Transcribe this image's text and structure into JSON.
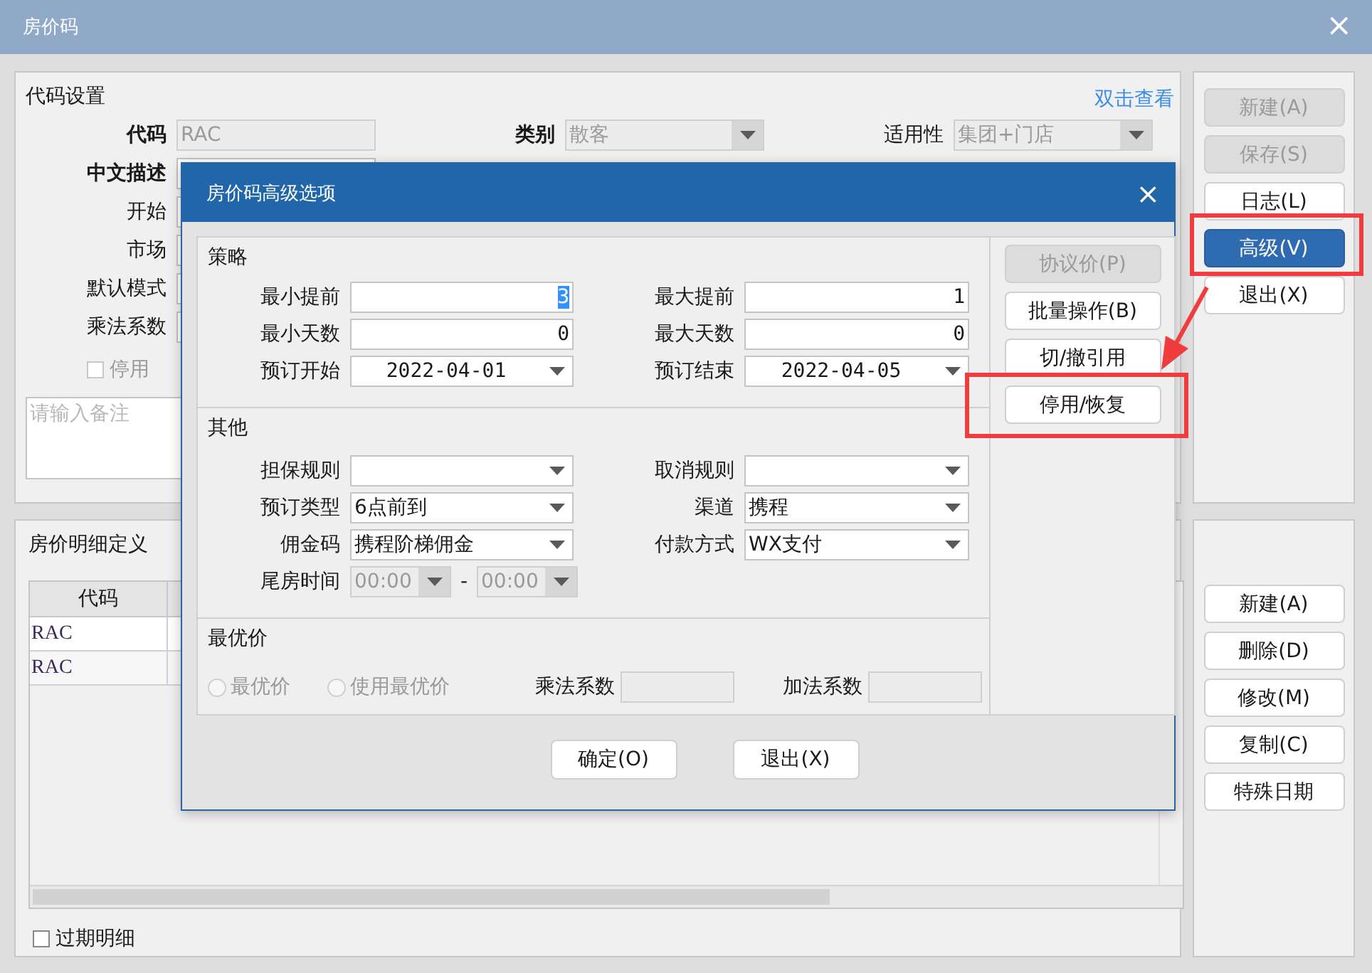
{
  "window": {
    "title": "房价码",
    "close": "×"
  },
  "code_settings": {
    "title": "代码设置",
    "link": "双击查看",
    "row1": [
      {
        "label": "代码",
        "bold": true,
        "field": {
          "kind": "text",
          "value": "RAC",
          "disabled": true
        }
      },
      {
        "label": "类别",
        "bold": true,
        "field": {
          "kind": "select",
          "value": "散客",
          "disabled": true
        }
      },
      {
        "label": "适用性",
        "bold": false,
        "field": {
          "kind": "select",
          "value": "集团+门店",
          "disabled": true
        }
      }
    ],
    "rows": [
      {
        "label": "中文描述",
        "bold": true
      },
      {
        "label": "开始",
        "bold": false
      },
      {
        "label": "市场",
        "bold": false
      },
      {
        "label": "默认模式",
        "bold": false
      },
      {
        "label": "乘法系数",
        "bold": false
      }
    ],
    "disable_check": {
      "label": "停用",
      "checked": false,
      "disabled": true
    },
    "remark": {
      "placeholder": "请输入备注"
    }
  },
  "main_buttons": [
    {
      "label": "新建(A)",
      "disabled": true,
      "selected": false
    },
    {
      "label": "保存(S)",
      "disabled": true,
      "selected": false
    },
    {
      "label": "日志(L)",
      "disabled": false,
      "selected": false
    },
    {
      "label": "高级(V)",
      "disabled": false,
      "selected": true
    },
    {
      "label": "退出(X)",
      "disabled": false,
      "selected": false
    }
  ],
  "detail": {
    "title": "房价明细定义",
    "columns": [
      "代码"
    ],
    "rows": [
      [
        "RAC"
      ],
      [
        "RAC"
      ]
    ],
    "expired_check": {
      "label": "过期明细",
      "checked": false
    }
  },
  "detail_buttons": [
    "新建(A)",
    "删除(D)",
    "修改(M)",
    "复制(C)",
    "特殊日期"
  ],
  "dialog": {
    "title": "房价码高级选项",
    "close": "×",
    "strategy": {
      "title": "策略",
      "rows": [
        [
          {
            "label": "最小提前",
            "field": {
              "kind": "number",
              "value": "3",
              "highlighted": true
            }
          },
          {
            "label": "最大提前",
            "field": {
              "kind": "number",
              "value": "1",
              "highlighted": false
            }
          }
        ],
        [
          {
            "label": "最小天数",
            "field": {
              "kind": "number",
              "value": "0",
              "highlighted": false
            }
          },
          {
            "label": "最大天数",
            "field": {
              "kind": "number",
              "value": "0",
              "highlighted": false
            }
          }
        ],
        [
          {
            "label": "预订开始",
            "field": {
              "kind": "date",
              "value": "2022-04-01",
              "highlighted": false
            }
          },
          {
            "label": "预订结束",
            "field": {
              "kind": "date",
              "value": "2022-04-05",
              "highlighted": false
            }
          }
        ]
      ]
    },
    "other": {
      "title": "其他",
      "rows": [
        [
          {
            "label": "担保规则",
            "field": {
              "kind": "select"
            }
          },
          {
            "label": "取消规则",
            "field": {
              "kind": "select"
            }
          }
        ],
        [
          {
            "label": "预订类型",
            "field": {
              "kind": "select",
              "value": "6点前到"
            }
          },
          {
            "label": "渠道",
            "field": {
              "kind": "select",
              "value": "携程"
            }
          }
        ],
        [
          {
            "label": "佣金码",
            "field": {
              "kind": "select",
              "value": "携程阶梯佣金"
            }
          },
          {
            "label": "付款方式",
            "field": {
              "kind": "select",
              "value": "WX支付"
            }
          }
        ]
      ],
      "tail_time": {
        "label": "尾房时间",
        "from": "00:00",
        "separator": "-",
        "to": "00:00",
        "disabled": true
      }
    },
    "best": {
      "title": "最优价",
      "options": [
        {
          "label": "最优价",
          "selected": false,
          "disabled": true
        },
        {
          "label": "使用最优价",
          "selected": false,
          "disabled": true
        }
      ],
      "factors": [
        {
          "label": "乘法系数",
          "disabled": true
        },
        {
          "label": "加法系数",
          "disabled": true
        }
      ]
    },
    "side_buttons": [
      {
        "label": "协议价(P)",
        "disabled": true,
        "highlighted": false
      },
      {
        "label": "批量操作(B)",
        "disabled": false,
        "highlighted": false
      },
      {
        "label": "切/撤引用",
        "disabled": false,
        "highlighted": false
      },
      {
        "label": "停用/恢复",
        "disabled": false,
        "highlighted": true
      }
    ],
    "footer": [
      "确定(O)",
      "退出(X)"
    ]
  }
}
